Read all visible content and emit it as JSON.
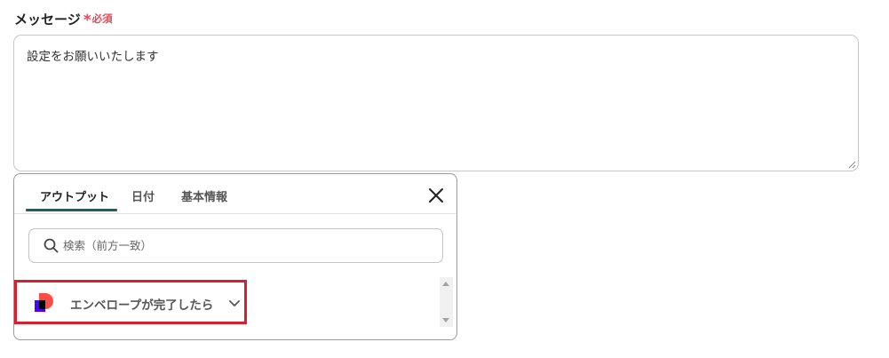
{
  "field": {
    "label": "メッセージ",
    "required_asterisk": "*",
    "required_text": "必須"
  },
  "message": {
    "value": "設定をお願いいたします"
  },
  "popup": {
    "tabs": [
      {
        "label": "アウトプット",
        "active": true
      },
      {
        "label": "日付",
        "active": false
      },
      {
        "label": "基本情報",
        "active": false
      }
    ],
    "search": {
      "placeholder": "検索（前方一致）",
      "value": ""
    },
    "items": [
      {
        "label": "エンベロープが完了したら",
        "icon": "app-logo-icon",
        "expanded": false
      }
    ]
  },
  "colors": {
    "accent": "#1d5f6d",
    "required": "#e2495a",
    "highlight_border": "#d7202e",
    "app_icon_red": "#ff4a4a",
    "app_icon_purple": "#4c00ff"
  }
}
